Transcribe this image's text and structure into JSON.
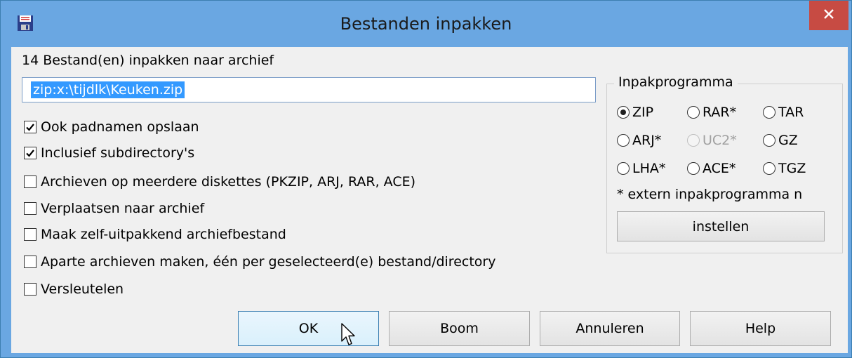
{
  "window": {
    "title": "Bestanden inpakken",
    "icon": "floppy-disk-icon",
    "close_icon": "close-icon",
    "titlebar_color": "#6aa7e2",
    "close_color": "#c74b43"
  },
  "main": {
    "header_label": "14 Bestand(en) inpakken naar archief",
    "archive_path": "zip:x:\\tijdlk\\Keuken.zip"
  },
  "options": [
    {
      "label": "Ook padnamen opslaan",
      "checked": true
    },
    {
      "label": "Inclusief subdirectory's",
      "checked": true
    },
    {
      "label": "Archieven op meerdere diskettes (PKZIP, ARJ, RAR, ACE)",
      "checked": false
    },
    {
      "label": "Verplaatsen naar archief",
      "checked": false
    },
    {
      "label": "Maak zelf-uitpakkend archiefbestand",
      "checked": false
    },
    {
      "label": "Aparte archieven maken, één per geselecteerd(e) bestand/directory",
      "checked": false
    },
    {
      "label": "Versleutelen",
      "checked": false
    }
  ],
  "packer": {
    "group_title": "Inpakprogramma",
    "radios": [
      {
        "label": "ZIP",
        "selected": true,
        "disabled": false
      },
      {
        "label": "RAR*",
        "selected": false,
        "disabled": false
      },
      {
        "label": "TAR",
        "selected": false,
        "disabled": false
      },
      {
        "label": "ARJ*",
        "selected": false,
        "disabled": false
      },
      {
        "label": "UC2*",
        "selected": false,
        "disabled": true
      },
      {
        "label": "GZ",
        "selected": false,
        "disabled": false
      },
      {
        "label": "LHA*",
        "selected": false,
        "disabled": false
      },
      {
        "label": "ACE*",
        "selected": false,
        "disabled": false
      },
      {
        "label": "TGZ",
        "selected": false,
        "disabled": false
      }
    ],
    "note": "* extern inpakprogramma n",
    "settings_button": "instellen"
  },
  "buttons": {
    "ok": "OK",
    "tree": "Boom",
    "cancel": "Annuleren",
    "help": "Help"
  },
  "cursor_icon": "mouse-pointer-icon"
}
